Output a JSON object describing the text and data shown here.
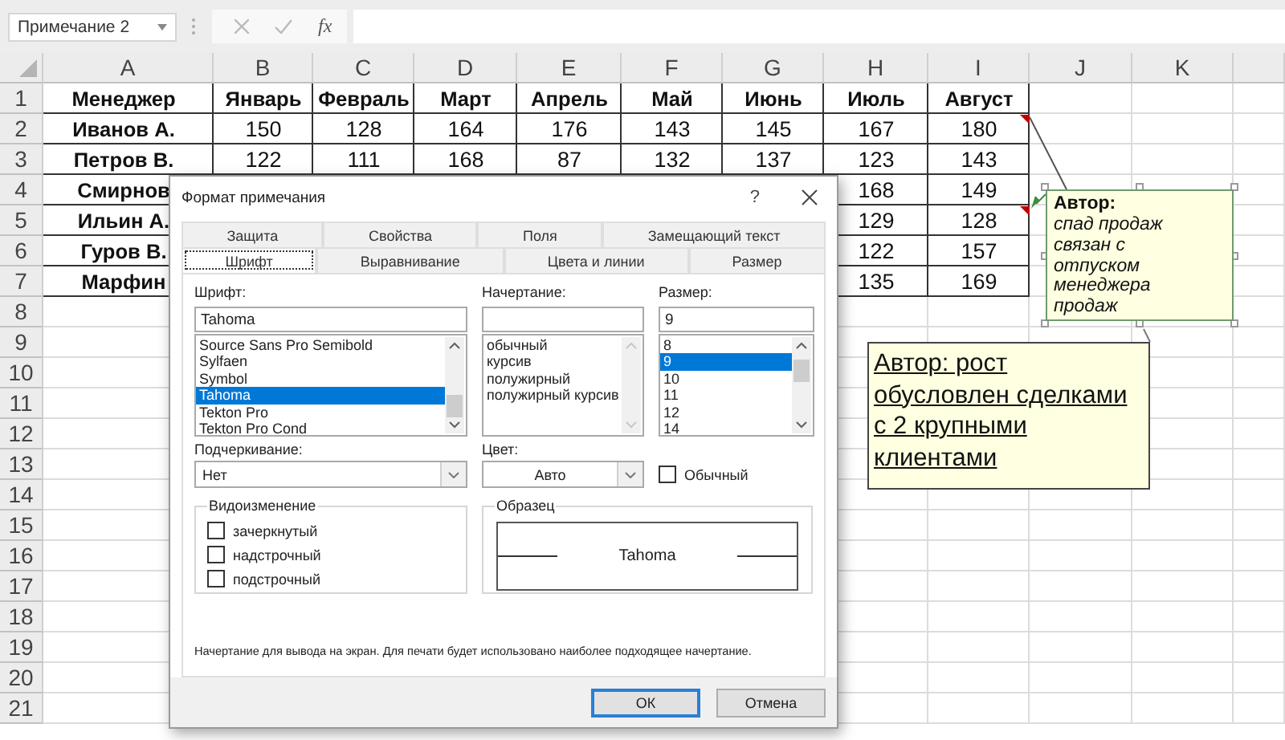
{
  "formula_bar": {
    "name_box": "Примечание 2",
    "function_button": "fx"
  },
  "sheet": {
    "columns": [
      "A",
      "B",
      "C",
      "D",
      "E",
      "F",
      "G",
      "H",
      "I",
      "J",
      "K"
    ],
    "rows": [
      {
        "number": "1",
        "cells": [
          "Менеджер",
          "Январь",
          "Февраль",
          "Март",
          "Апрель",
          "Май",
          "Июнь",
          "Июль",
          "Август"
        ]
      },
      {
        "number": "2",
        "cells": [
          "Иванов А.",
          "150",
          "128",
          "164",
          "176",
          "143",
          "145",
          "167",
          "180"
        ]
      },
      {
        "number": "3",
        "cells": [
          "Петров В.",
          "122",
          "111",
          "168",
          "87",
          "132",
          "137",
          "123",
          "143"
        ]
      },
      {
        "number": "4",
        "cells": [
          "Смирнов",
          "168",
          "149"
        ]
      },
      {
        "number": "5",
        "cells": [
          "Ильин А.",
          "129",
          "128"
        ]
      },
      {
        "number": "6",
        "cells": [
          "Гуров В.",
          "122",
          "157"
        ]
      },
      {
        "number": "7",
        "cells": [
          "Марфин",
          "135",
          "169"
        ]
      },
      {
        "number": "8"
      },
      {
        "number": "9"
      },
      {
        "number": "10"
      },
      {
        "number": "11"
      },
      {
        "number": "12"
      },
      {
        "number": "13"
      },
      {
        "number": "14"
      },
      {
        "number": "15"
      },
      {
        "number": "16"
      },
      {
        "number": "17"
      },
      {
        "number": "18"
      },
      {
        "number": "19"
      },
      {
        "number": "20"
      },
      {
        "number": "21"
      }
    ]
  },
  "comments": [
    {
      "kind": "note",
      "author": "Автор:",
      "text": "спад продаж связан с отпуском менеджера продаж",
      "selected": true
    },
    {
      "kind": "underlined",
      "text": "Автор: рост обусловлен сделками с 2 крупными клиентами",
      "selected": false
    }
  ],
  "dialog": {
    "title": "Формат примечания",
    "help_button": "?",
    "tab_rows": [
      [
        {
          "label": "Защита",
          "selected": false
        },
        {
          "label": "Свойства",
          "selected": false
        },
        {
          "label": "Поля",
          "selected": false
        },
        {
          "label": "Замещающий текст",
          "selected": false
        }
      ],
      [
        {
          "label": "Шрифт",
          "selected": true
        },
        {
          "label": "Выравнивание",
          "selected": false
        },
        {
          "label": "Цвета и линии",
          "selected": false
        },
        {
          "label": "Размер",
          "selected": false
        }
      ]
    ],
    "font": {
      "label": "Шрифт:",
      "value": "Tahoma",
      "options": [
        {
          "label": "Source Sans Pro Semibold",
          "selected": false
        },
        {
          "label": "Sylfaen",
          "selected": false
        },
        {
          "label": "Symbol",
          "selected": false
        },
        {
          "label": "Tahoma",
          "selected": true
        },
        {
          "label": "Tekton Pro",
          "selected": false
        },
        {
          "label": "Tekton Pro Cond",
          "selected": false
        }
      ]
    },
    "style": {
      "label": "Начертание:",
      "options": [
        {
          "label": "обычный",
          "selected": false
        },
        {
          "label": "курсив",
          "selected": false
        },
        {
          "label": "полужирный",
          "selected": false
        },
        {
          "label": "полужирный курсив",
          "selected": false
        }
      ]
    },
    "size": {
      "label": "Размер:",
      "value": "9",
      "options": [
        {
          "label": "8",
          "selected": false
        },
        {
          "label": "9",
          "selected": true
        },
        {
          "label": "10",
          "selected": false
        },
        {
          "label": "11",
          "selected": false
        },
        {
          "label": "12",
          "selected": false
        },
        {
          "label": "14",
          "selected": false
        }
      ]
    },
    "underline": {
      "label": "Подчеркивание:",
      "value": "Нет"
    },
    "color": {
      "label": "Цвет:",
      "value": "Авто"
    },
    "normal_font": {
      "label": "Обычный",
      "checked": false
    },
    "effects": {
      "title": "Видоизменение",
      "options": [
        {
          "label": "зачеркнутый",
          "checked": false
        },
        {
          "label": "надстрочный",
          "checked": false
        },
        {
          "label": "подстрочный",
          "checked": false
        }
      ]
    },
    "preview": {
      "title": "Образец",
      "text": "Tahoma"
    },
    "note": "Начертание для вывода на экран. Для печати будет использовано наиболее подходящее начертание.",
    "buttons": [
      {
        "label": "ОК",
        "default": true
      },
      {
        "label": "Отмена",
        "default": false
      }
    ]
  }
}
